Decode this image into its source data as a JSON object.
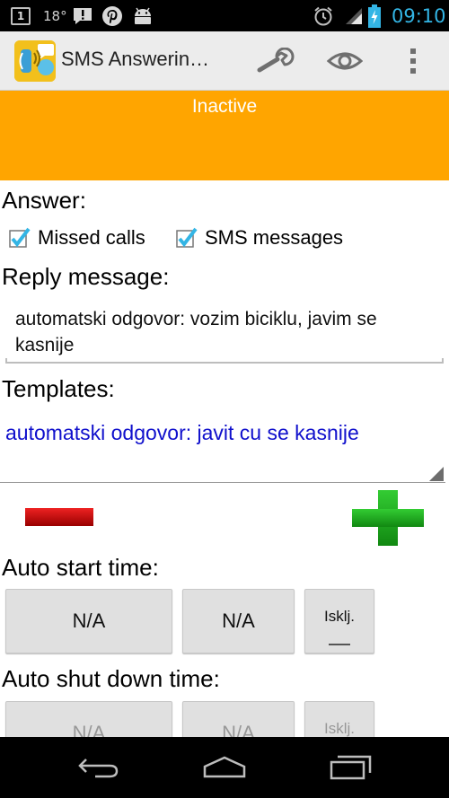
{
  "status_bar": {
    "notification_badge": "1",
    "temperature": "18°",
    "time": "09:10",
    "icons": [
      "notification-icon",
      "alert-icon",
      "pinterest-icon",
      "android-icon",
      "alarm-icon",
      "signal-icon",
      "battery-icon"
    ]
  },
  "action_bar": {
    "title": "SMS Answerin…",
    "icons": [
      "app-icon",
      "wrench-icon",
      "eye-icon",
      "overflow-menu-icon"
    ]
  },
  "banner": {
    "status_text": "Inactive",
    "color": "#ffa500"
  },
  "answer": {
    "label": "Answer:",
    "options": [
      {
        "label": "Missed calls",
        "checked": true
      },
      {
        "label": "SMS messages",
        "checked": true
      }
    ]
  },
  "reply": {
    "label": "Reply message:",
    "value": "automatski odgovor: vozim biciklu, javim se kasnije"
  },
  "templates": {
    "label": "Templates:",
    "selected": "automatski odgovor: javit cu se kasnije"
  },
  "auto_start": {
    "label": "Auto start time:",
    "buttons": [
      "N/A",
      "N/A",
      "Isklj."
    ]
  },
  "auto_shutdown": {
    "label": "Auto shut down time:",
    "buttons": [
      "N/A",
      "N/A",
      "Isklj."
    ]
  },
  "colors": {
    "accent_blue": "#33b5e5",
    "template_text": "#1010cc",
    "remove_red": "#cc0000",
    "add_green": "#22bb22"
  }
}
